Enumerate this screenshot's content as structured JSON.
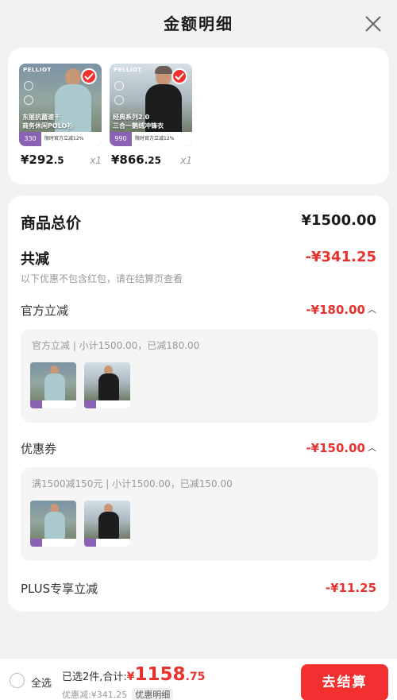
{
  "header": {
    "title": "金额明细",
    "close_icon": "close-icon"
  },
  "products": [
    {
      "brand": "PELLIOT",
      "caption_line1": "东丽抗菌速干",
      "caption_line2": "商务休闲POLO衫",
      "tag_price": "330",
      "tag_text": "限时官方立减12%",
      "price_int": "¥292",
      "price_dec": ".5",
      "qty": "x1",
      "checked": true
    },
    {
      "brand": "PELLIOT",
      "caption_line1": "经典系列2.0",
      "caption_line2": "三合一鹅绒冲锋衣",
      "tag_price": "990",
      "tag_text": "限时官方立减12%",
      "price_int": "¥866",
      "price_dec": ".25",
      "qty": "x1",
      "checked": true
    }
  ],
  "summary": {
    "total_label": "商品总价",
    "total_value": "¥1500.00",
    "discount_label": "共减",
    "discount_value": "-¥341.25",
    "discount_note": "以下优惠不包含红包，请在结算页查看",
    "official": {
      "label": "官方立减",
      "value": "-¥180.00",
      "detail": "官方立减 | 小计1500.00，已减180.00"
    },
    "coupon": {
      "label": "优惠券",
      "value": "-¥150.00",
      "detail": "满1500减150元 | 小计1500.00，已减150.00"
    },
    "plus": {
      "label": "PLUS专享立减",
      "value": "-¥11.25"
    }
  },
  "footer": {
    "select_all": "全选",
    "selected_label": "已选2件,合计:",
    "currency": "¥",
    "total_int": "1158",
    "total_dec": ".75",
    "saved_label": "优惠减:¥341.25",
    "detail_link": "优惠明细",
    "checkout_button": "去结算"
  },
  "colors": {
    "accent": "#f2302f",
    "discount_red": "#e8322e",
    "tag_purple": "#8a62b3"
  }
}
